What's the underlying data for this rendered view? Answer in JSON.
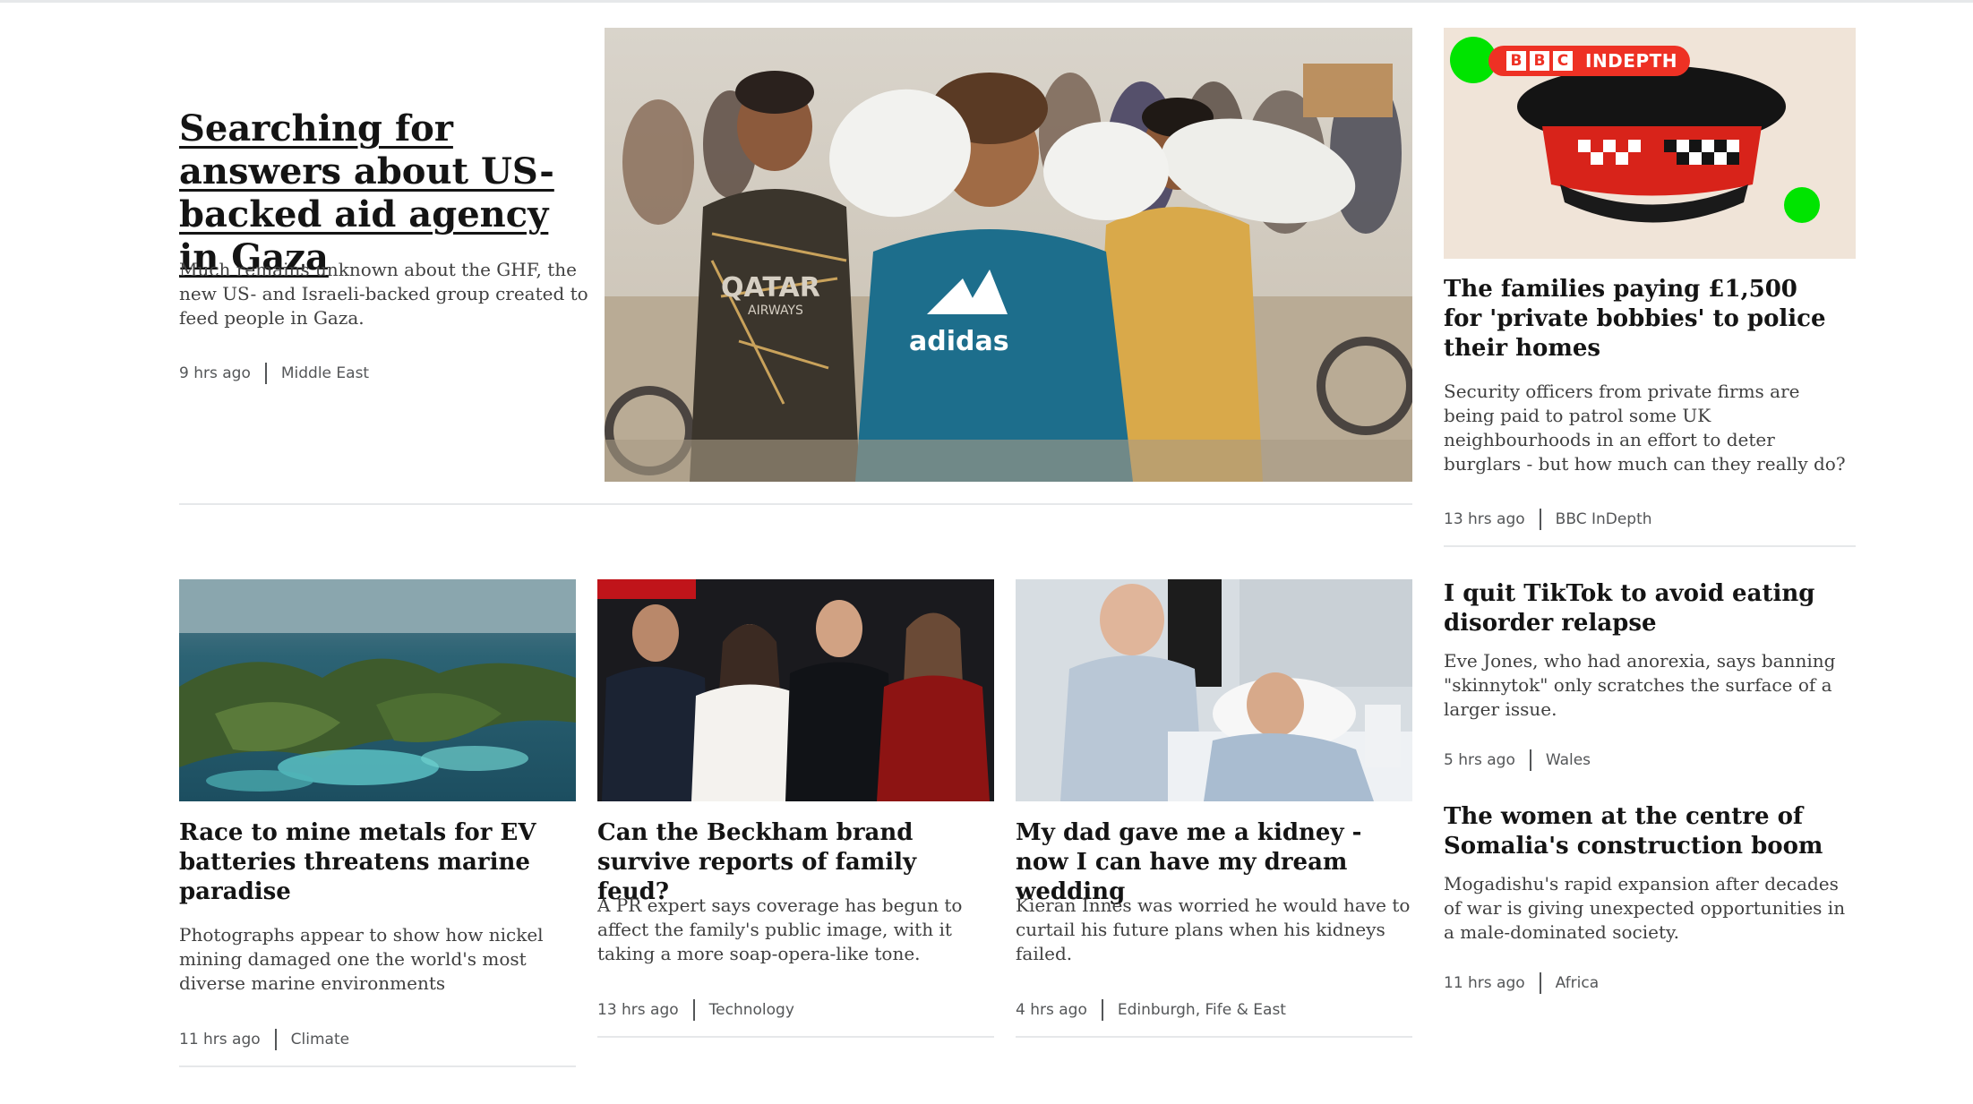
{
  "lead": {
    "title": "Searching for answers about US-backed aid agency in Gaza",
    "summary": "Much remains unknown about the GHF, the new US- and Israeli-backed group created to feed people in Gaza.",
    "time": "9 hrs ago",
    "section": "Middle East"
  },
  "indepth": {
    "badge_bbc": [
      "B",
      "B",
      "C"
    ],
    "badge_label": "INDEPTH",
    "title": "The families paying £1,500 for 'private bobbies' to police their homes",
    "summary": "Security officers from private firms are being paid to patrol some UK neighbourhoods in an effort to deter burglars - but how much can they really do?",
    "time": "13 hrs ago",
    "section": "BBC InDepth"
  },
  "cards": [
    {
      "title": "Race to mine metals for EV batteries threatens marine paradise",
      "summary": "Photographs appear to show how nickel mining damaged one the world's most diverse marine environments",
      "time": "11 hrs ago",
      "section": "Climate"
    },
    {
      "title": "Can the Beckham brand survive reports of family feud?",
      "summary": "A PR expert says coverage has begun to affect the family's public image, with it taking a more soap-opera-like tone.",
      "time": "13 hrs ago",
      "section": "Technology"
    },
    {
      "title": "My dad gave me a kidney - now I can have my dream wedding",
      "summary": "Kieran Innes was worried he would have to curtail his future plans when his kidneys failed.",
      "time": "4 hrs ago",
      "section": "Edinburgh, Fife & East"
    }
  ],
  "side": [
    {
      "title": "I quit TikTok to avoid eating disorder relapse",
      "summary": "Eve Jones, who had anorexia, says banning \"skinnytok\" only scratches the surface of a larger issue.",
      "time": "5 hrs ago",
      "section": "Wales"
    },
    {
      "title": "The women at the centre of Somalia's construction boom",
      "summary": "Mogadishu's rapid expansion after decades of war is giving unexpected opportunities in a male-dominated society.",
      "time": "11 hrs ago",
      "section": "Africa"
    }
  ],
  "image_text": {
    "shirt_brand": "QATAR",
    "shirt_brand_sub": "AIRWAYS",
    "shirt_logo": "adidas"
  },
  "colors": {
    "accent_red": "#ee3124",
    "accent_green": "#00e400",
    "rule": "#e6e8ea",
    "meta": "#545658"
  }
}
